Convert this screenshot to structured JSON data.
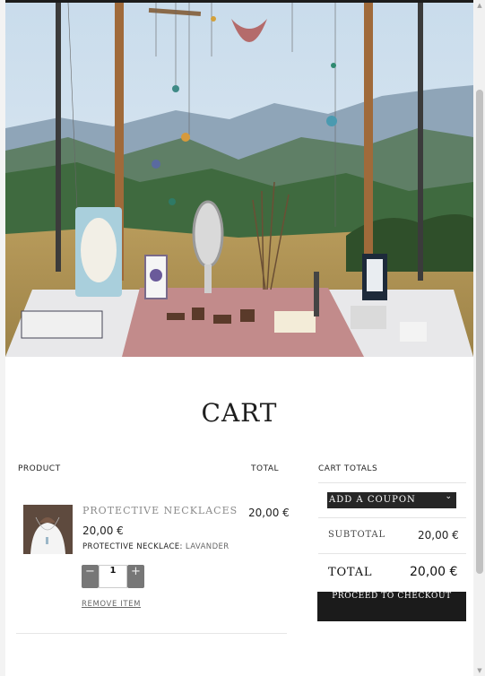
{
  "cart": {
    "title": "CART",
    "headers": {
      "product": "PRODUCT",
      "total": "TOTAL",
      "cart_totals": "CART TOTALS"
    },
    "item": {
      "name": "PROTECTIVE NECKLACES",
      "price": "20,00 €",
      "variant_label": "PROTECTIVE NECKLACE:",
      "variant_value": "LAVANDER",
      "quantity": "1",
      "decrement_symbol": "−",
      "increment_symbol": "+",
      "remove_label": "REMOVE ITEM",
      "line_total": "20,00 €"
    },
    "totals": {
      "coupon_label": "ADD A COUPON",
      "coupon_icon": "chevron-down-icon",
      "subtotal_label": "SUBTOTAL",
      "subtotal_value": "20,00 €",
      "total_label": "TOTAL",
      "total_value": "20,00 €",
      "checkout_label": "PROCEED TO CHECKOUT"
    }
  },
  "colors": {
    "dark_button": "#1b1b1b",
    "qty_button": "#777777",
    "muted_text": "#8a8a8a"
  }
}
